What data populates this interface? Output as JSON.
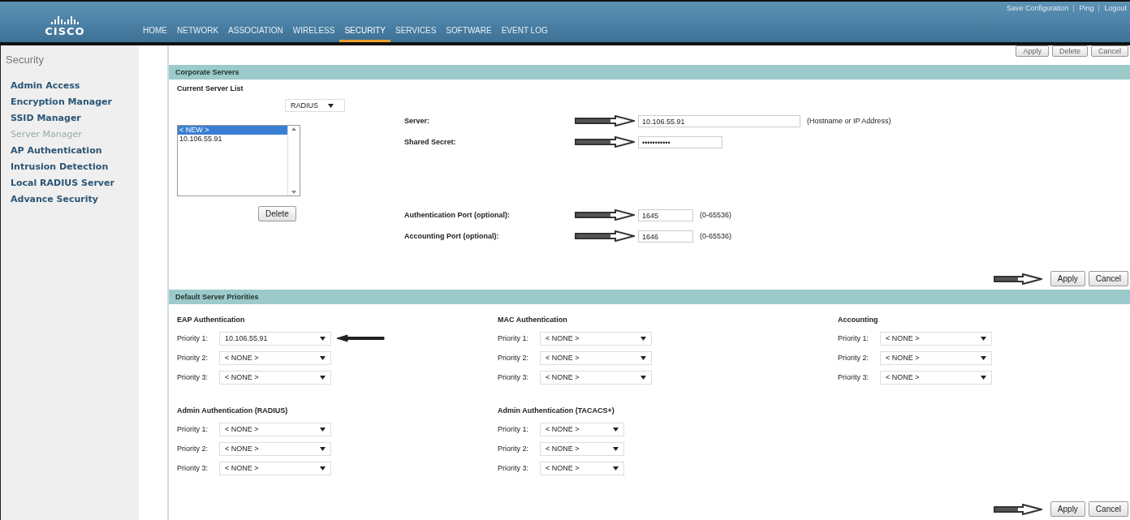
{
  "header": {
    "logo": "CISCO",
    "nav": [
      {
        "label": "HOME",
        "selected": false
      },
      {
        "label": "NETWORK",
        "selected": false
      },
      {
        "label": "ASSOCIATION",
        "selected": false
      },
      {
        "label": "WIRELESS",
        "selected": false
      },
      {
        "label": "SECURITY",
        "selected": true
      },
      {
        "label": "SERVICES",
        "selected": false
      },
      {
        "label": "SOFTWARE",
        "selected": false
      },
      {
        "label": "EVENT LOG",
        "selected": false
      }
    ],
    "links": [
      "Save Configuration",
      "Ping",
      "Logout"
    ]
  },
  "top_buttons": [
    "Apply",
    "Delete",
    "Cancel"
  ],
  "sidebar": {
    "title": "Security",
    "items": [
      {
        "label": "Admin Access",
        "selected": false
      },
      {
        "label": "Encryption Manager",
        "selected": false
      },
      {
        "label": "SSID Manager",
        "selected": false
      },
      {
        "label": "Server Manager",
        "selected": true
      },
      {
        "label": "AP Authentication",
        "selected": false
      },
      {
        "label": "Intrusion Detection",
        "selected": false
      },
      {
        "label": "Local RADIUS Server",
        "selected": false
      },
      {
        "label": "Advance Security",
        "selected": false
      }
    ]
  },
  "corporate_servers": {
    "title": "Corporate Servers",
    "list_title": "Current Server List",
    "server_type": "RADIUS",
    "server_list": [
      {
        "label": "< NEW >",
        "selected": true
      },
      {
        "label": "10.106.55.91",
        "selected": false
      }
    ],
    "delete_button": "Delete",
    "fields": [
      {
        "kind": "host",
        "label": "Server:",
        "value": "10.106.55.91",
        "hint": "(Hostname or IP Address)",
        "marked": true
      },
      {
        "kind": "secret",
        "label": "Shared Secret:",
        "value": "•••••••••••",
        "marked": true
      },
      {
        "kind": "port",
        "label": "Authentication Port (optional):",
        "value": "1645",
        "hint": "(0-65536)",
        "marked": true
      },
      {
        "kind": "port",
        "label": "Accounting Port (optional):",
        "value": "1646",
        "hint": "(0-65536)",
        "marked": true
      }
    ],
    "buttons": [
      "Apply",
      "Cancel"
    ],
    "buttons_marked": true
  },
  "default_priorities": {
    "title": "Default Server Priorities",
    "groups": [
      {
        "title": "EAP Authentication",
        "priorities": [
          {
            "label": "Priority 1:",
            "value": "10.106.55.91",
            "marked": true
          },
          {
            "label": "Priority 2:",
            "value": "< NONE >",
            "marked": false
          },
          {
            "label": "Priority 3:",
            "value": "< NONE >",
            "marked": false
          }
        ]
      },
      {
        "title": "MAC Authentication",
        "priorities": [
          {
            "label": "Priority 1:",
            "value": "< NONE >",
            "marked": false
          },
          {
            "label": "Priority 2:",
            "value": "< NONE >",
            "marked": false
          },
          {
            "label": "Priority 3:",
            "value": "< NONE >",
            "marked": false
          }
        ]
      },
      {
        "title": "Accounting",
        "priorities": [
          {
            "label": "Priority 1:",
            "value": "< NONE >",
            "marked": false
          },
          {
            "label": "Priority 2:",
            "value": "< NONE >",
            "marked": false
          },
          {
            "label": "Priority 3:",
            "value": "< NONE >",
            "marked": false
          }
        ]
      },
      {
        "title": "Admin Authentication (RADIUS)",
        "priorities": [
          {
            "label": "Priority 1:",
            "value": "< NONE >",
            "marked": false
          },
          {
            "label": "Priority 2:",
            "value": "< NONE >",
            "marked": false
          },
          {
            "label": "Priority 3:",
            "value": "< NONE >",
            "marked": false
          }
        ]
      },
      {
        "title": "Admin Authentication (TACACS+)",
        "priorities": [
          {
            "label": "Priority 1:",
            "value": "< NONE >",
            "marked": false
          },
          {
            "label": "Priority 2:",
            "value": "< NONE >",
            "marked": false
          },
          {
            "label": "Priority 3:",
            "value": "< NONE >",
            "marked": false
          }
        ]
      }
    ],
    "buttons": [
      "Apply",
      "Cancel"
    ],
    "buttons_marked": true
  }
}
